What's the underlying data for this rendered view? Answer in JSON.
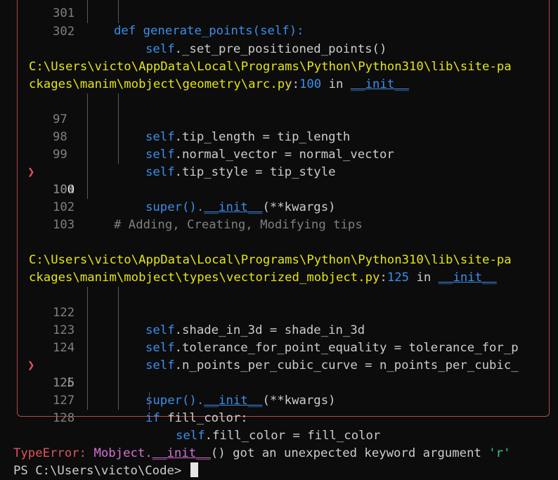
{
  "traceback": {
    "top_partial": {
      "num": "302",
      "code": "self._set_pre_positioned_points()"
    },
    "frame1": {
      "path_line1": "C:\\Users\\victo\\AppData\\Local\\Programs\\Python\\Python310\\lib\\site-pa",
      "path_line2": "ckages\\manim\\mobject\\geometry\\arc.py",
      "lineno": "100",
      "in_word": "in",
      "func": "__init__",
      "lines": [
        {
          "num": "97",
          "self": "self",
          "rest": ".tip_length = tip_length"
        },
        {
          "num": "98",
          "self": "self",
          "rest": ".normal_vector = normal_vector"
        },
        {
          "num": "99",
          "self": "self",
          "rest": ".tip_style = tip_style"
        },
        {
          "num": "100",
          "pre": "super().",
          "func": "__init__",
          "post": "(**kwargs)"
        },
        {
          "num": "101"
        },
        {
          "num": "102",
          "comment": "# Adding, Creating, Modifying tips"
        },
        {
          "num": "103"
        }
      ]
    },
    "frame2": {
      "path_line1": "C:\\Users\\victo\\AppData\\Local\\Programs\\Python\\Python310\\lib\\site-pa",
      "path_line2": "ckages\\manim\\mobject\\types\\vectorized_mobject.py",
      "lineno": "125",
      "in_word": "in",
      "func": "__init__",
      "lines": [
        {
          "num": "122",
          "self": "self",
          "rest": ".shade_in_3d = shade_in_3d"
        },
        {
          "num": "123",
          "self": "self",
          "rest": ".tolerance_for_point_equality = tolerance_for_p"
        },
        {
          "num": "124",
          "self": "self",
          "rest": ".n_points_per_cubic_curve = n_points_per_cubic_"
        },
        {
          "num": "125",
          "pre": "super().",
          "func": "__init__",
          "post": "(**kwargs)"
        },
        {
          "num": "126"
        },
        {
          "num": "127",
          "kw": "if",
          "rest": " fill_color:"
        },
        {
          "num": "128",
          "self": "self",
          "rest": ".fill_color = fill_color"
        }
      ]
    },
    "arrow_glyph": "❯"
  },
  "error": {
    "type": "TypeError:",
    "cls": "Mobject.",
    "func": "__init__",
    "message": "() got an unexpected keyword argument ",
    "arg": "'r'"
  },
  "prompt": {
    "text": "PS C:\\Users\\victo\\Code> "
  },
  "colors": {
    "background": "#0c0c0c",
    "path": "#e5e510",
    "keyword_blue": "#3b8eea",
    "error_red": "#e05260",
    "error_magenta": "#d670d6",
    "string_green": "#23d18b"
  }
}
